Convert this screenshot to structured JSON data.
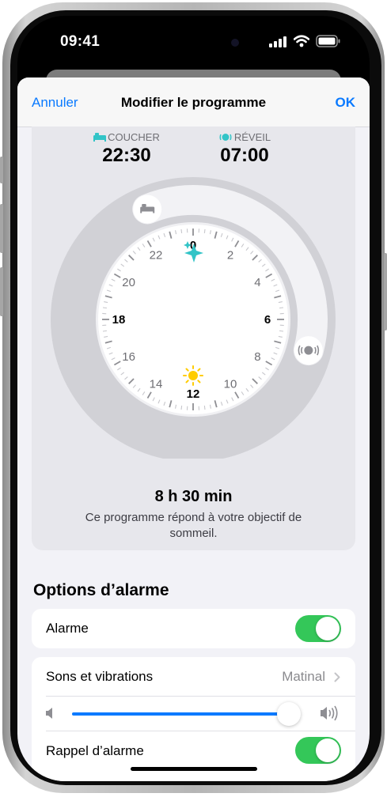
{
  "status_bar": {
    "time": "09:41"
  },
  "nav": {
    "cancel": "Annuler",
    "title": "Modifier le programme",
    "done": "OK"
  },
  "schedule": {
    "bedtime_label": "COUCHER",
    "bedtime": "22:30",
    "wake_label": "RÉVEIL",
    "wake": "07:00",
    "clock_hours": [
      "0",
      "2",
      "4",
      "6",
      "8",
      "10",
      "12",
      "14",
      "16",
      "18",
      "20",
      "22"
    ],
    "duration": "8 h 30 min",
    "goal_text": "Ce programme répond à votre objectif de sommeil."
  },
  "alarm_options": {
    "title": "Options d’alarme",
    "alarm_label": "Alarme",
    "alarm_on": true,
    "sounds_label": "Sons et vibrations",
    "sounds_value": "Matinal",
    "volume_fraction": 0.98,
    "snooze_label": "Rappel d’alarme",
    "snooze_on": true
  },
  "colors": {
    "accent": "#0a7aff",
    "toggle_on": "#34c759",
    "sparkle": "#32c4c7",
    "sun": "#ffcc00"
  }
}
